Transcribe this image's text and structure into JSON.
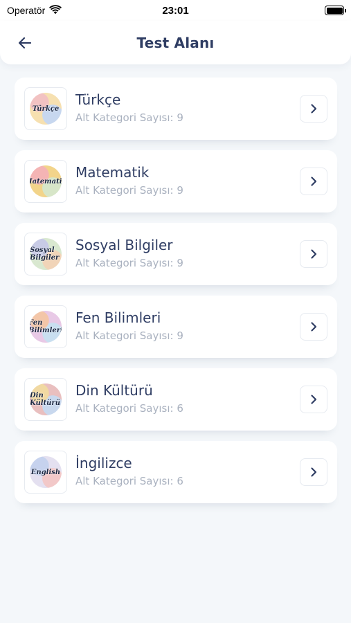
{
  "status_bar": {
    "carrier": "Operatör",
    "time": "23:01"
  },
  "header": {
    "title": "Test Alanı"
  },
  "categories": [
    {
      "title": "Türkçe",
      "subtitle": "Alt Kategori Sayısı: 9",
      "thumb_word": "Türkçe",
      "thumb_colors": [
        "#f2c2c2",
        "#c7d7ef",
        "#f6e0b0"
      ]
    },
    {
      "title": "Matematik",
      "subtitle": "Alt Kategori Sayısı: 9",
      "thumb_word": "Matematik",
      "thumb_colors": [
        "#f4b4b4",
        "#d7e6c8",
        "#f2d48a"
      ]
    },
    {
      "title": "Sosyal Bilgiler",
      "subtitle": "Alt Kategori Sayısı: 9",
      "thumb_word": "Sosyal Bilgiler",
      "thumb_colors": [
        "#c8cbe6",
        "#f1d4b8",
        "#d9e8d0"
      ]
    },
    {
      "title": "Fen Bilimleri",
      "subtitle": "Alt Kategori Sayısı: 9",
      "thumb_word": "Fen Bilimleri",
      "thumb_colors": [
        "#f3c6a8",
        "#c9dff0",
        "#e8c9e6"
      ]
    },
    {
      "title": "Din Kültürü",
      "subtitle": "Alt Kategori Sayısı: 6",
      "thumb_word": "Din Kültürü",
      "thumb_colors": [
        "#f1d9a2",
        "#c8d8ee",
        "#e9bfbf"
      ]
    },
    {
      "title": "İngilizce",
      "subtitle": "Alt Kategori Sayısı: 6",
      "thumb_word": "English",
      "thumb_colors": [
        "#c6d2ee",
        "#f2c8c8",
        "#e4e0f0"
      ]
    }
  ]
}
